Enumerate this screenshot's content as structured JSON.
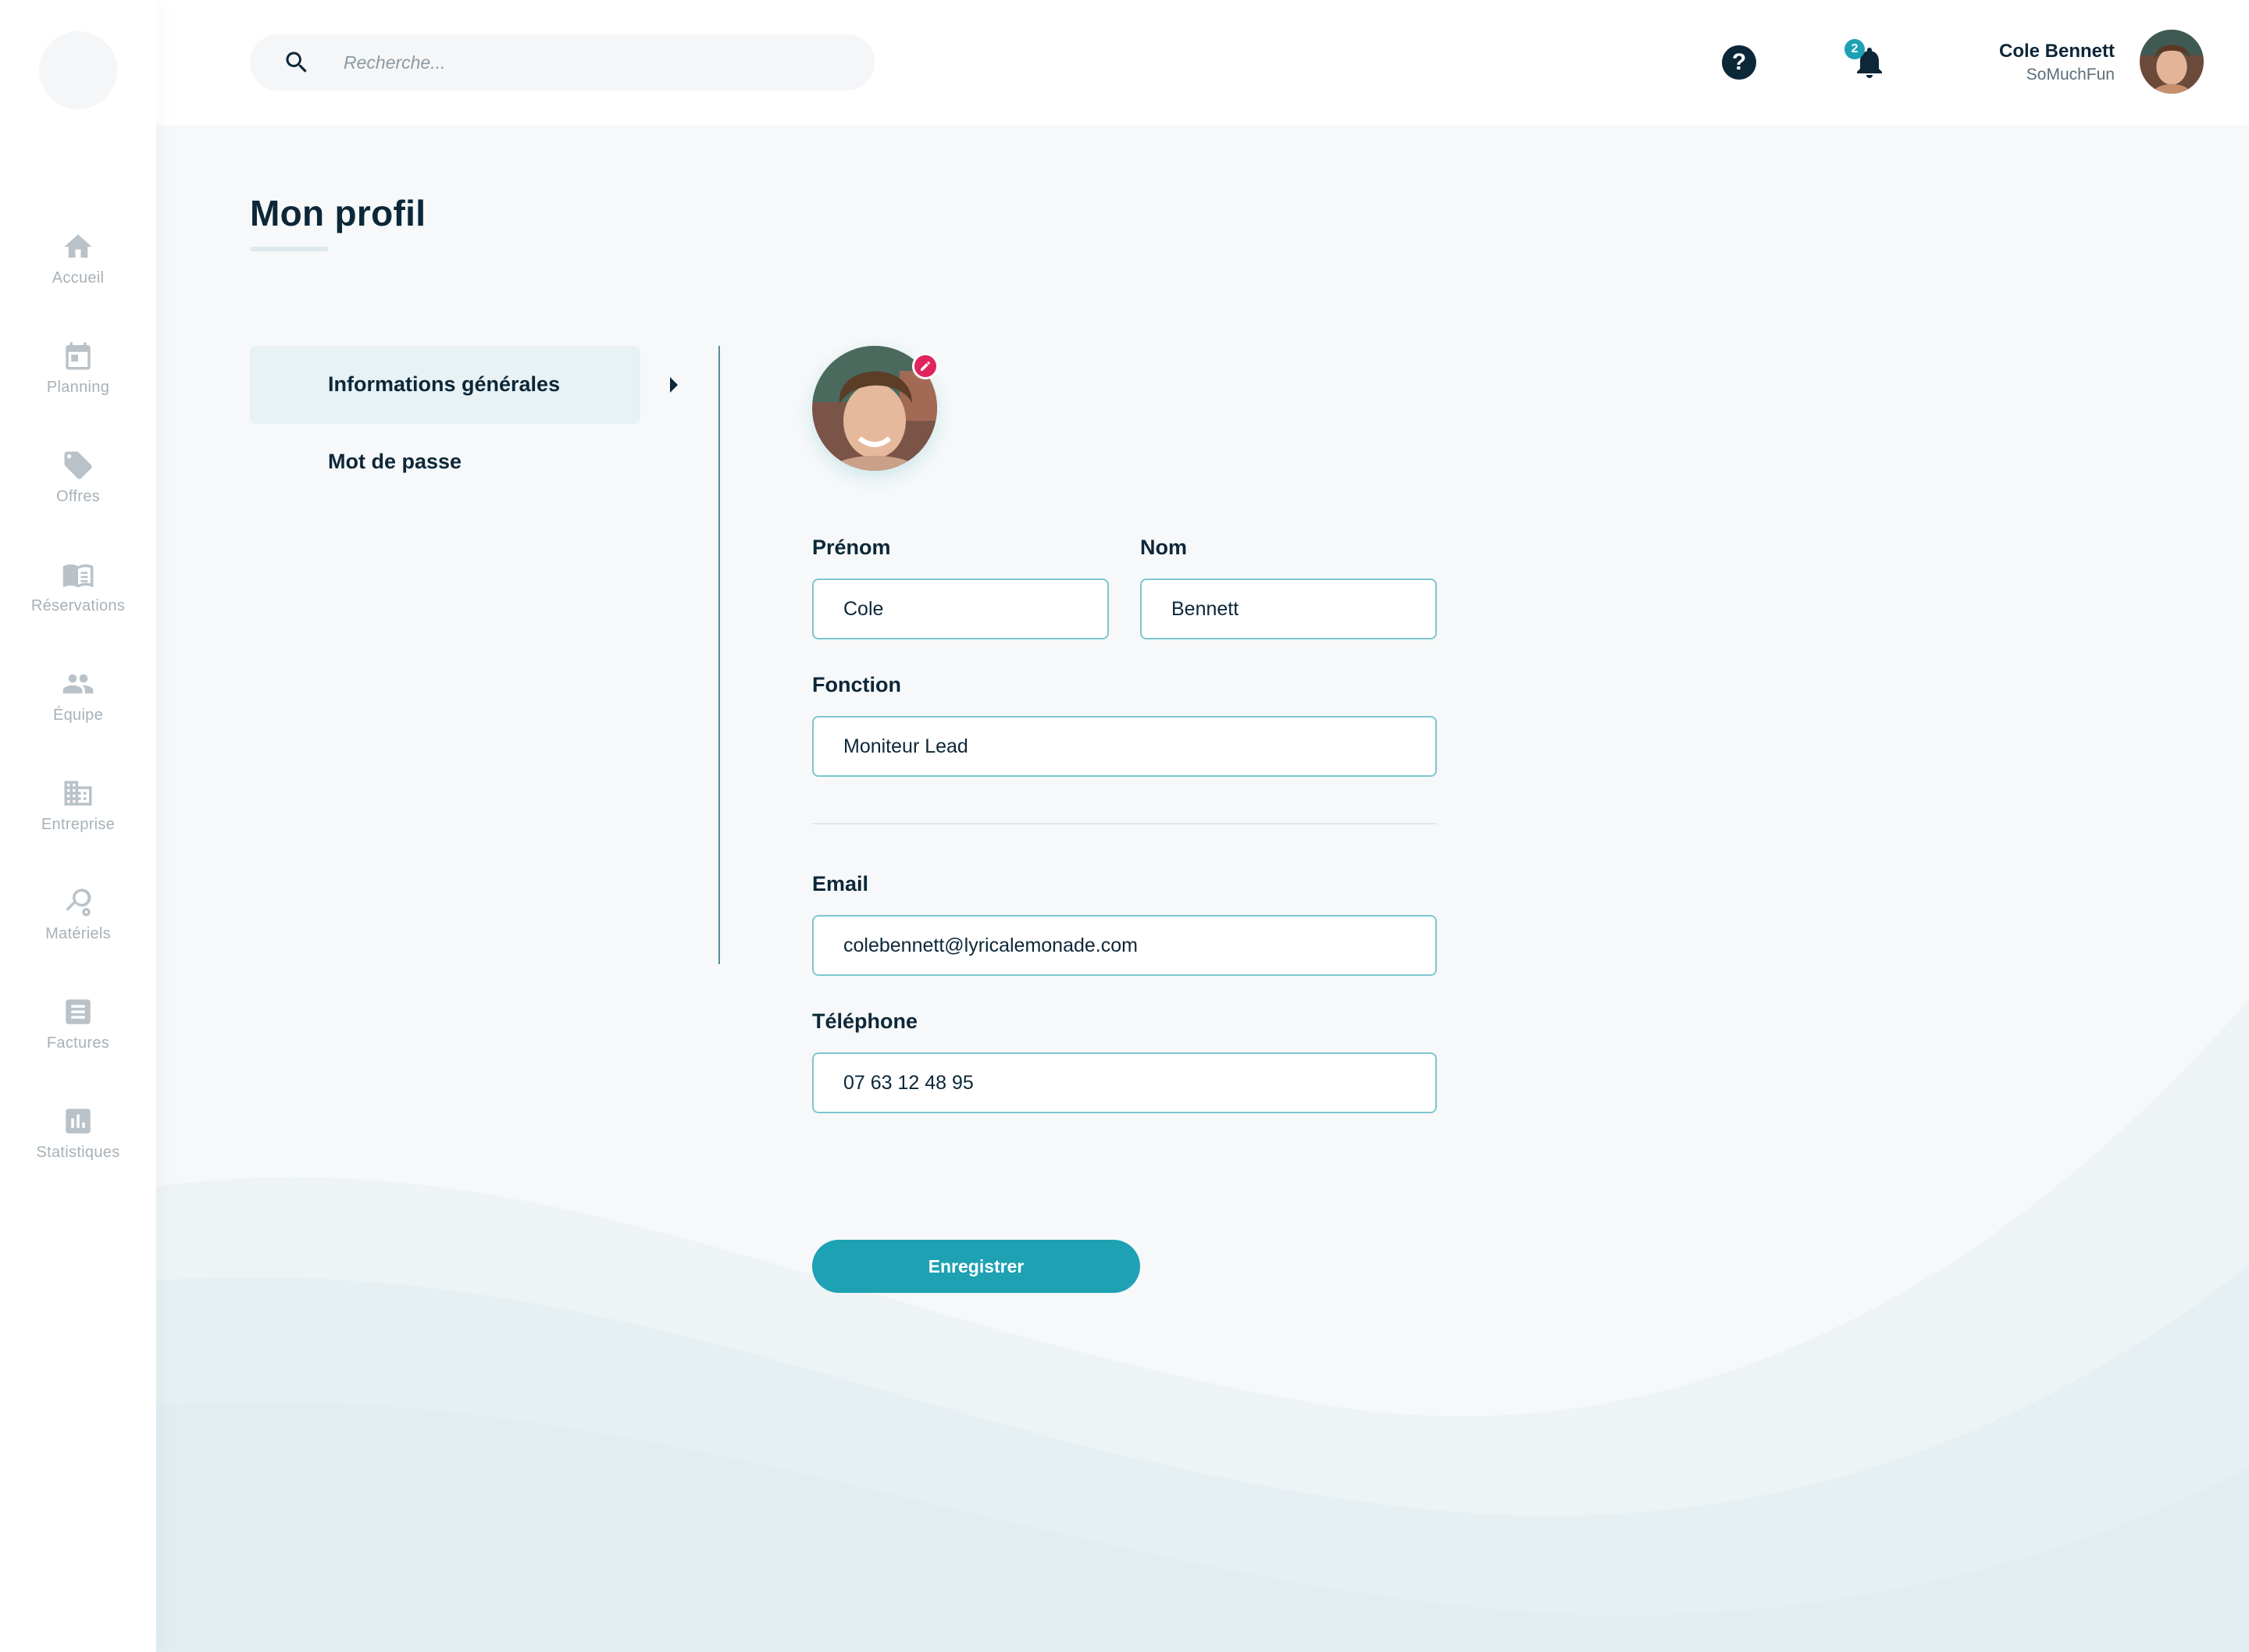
{
  "sidebar": {
    "items": [
      {
        "label": "Accueil",
        "icon": "home-icon"
      },
      {
        "label": "Planning",
        "icon": "calendar-icon"
      },
      {
        "label": "Offres",
        "icon": "tag-icon"
      },
      {
        "label": "Réservations",
        "icon": "book-icon"
      },
      {
        "label": "Équipe",
        "icon": "people-icon"
      },
      {
        "label": "Entreprise",
        "icon": "building-icon"
      },
      {
        "label": "Matériels",
        "icon": "racket-icon"
      },
      {
        "label": "Factures",
        "icon": "invoice-icon"
      },
      {
        "label": "Statistiques",
        "icon": "chart-icon"
      }
    ]
  },
  "header": {
    "search_placeholder": "Recherche...",
    "help_icon": "?",
    "notification_count": "2",
    "user_name": "Cole Bennett",
    "user_company": "SoMuchFun"
  },
  "page": {
    "title": "Mon profil"
  },
  "subnav": {
    "items": [
      {
        "label": "Informations générales",
        "active": true
      },
      {
        "label": "Mot de passe",
        "active": false
      }
    ]
  },
  "form": {
    "first_name": {
      "label": "Prénom",
      "value": "Cole"
    },
    "last_name": {
      "label": "Nom",
      "value": "Bennett"
    },
    "function": {
      "label": "Fonction",
      "value": "Moniteur Lead"
    },
    "email": {
      "label": "Email",
      "value": "colebennett@lyricalemonade.com"
    },
    "phone": {
      "label": "Téléphone",
      "value": "07 63 12 48 95"
    },
    "save_label": "Enregistrer"
  },
  "colors": {
    "accent": "#1da1b3",
    "text_dark": "#0c2738",
    "edit_badge": "#e0245e",
    "background": "#f6f8f9"
  }
}
